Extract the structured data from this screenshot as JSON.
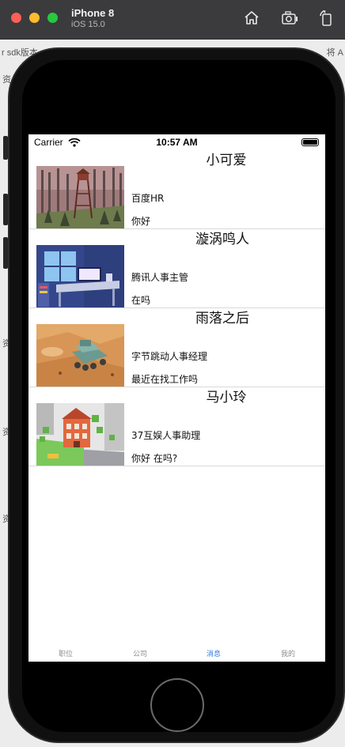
{
  "simulator": {
    "device_name": "iPhone 8",
    "os_version": "iOS 15.0",
    "toolbar_icons": [
      "home-icon",
      "screenshot-icon",
      "rotate-icon"
    ]
  },
  "background_fragments": {
    "left_top": "r sdk版本",
    "right_top": "将 A",
    "left_1": "资",
    "left_2": "资",
    "left_3": "资",
    "left_4": "资"
  },
  "status_bar": {
    "carrier": "Carrier",
    "time": "10:57 AM"
  },
  "messages": [
    {
      "name": "小可爱",
      "title": "百度HR",
      "message": "你好",
      "image": "forest-watchtower"
    },
    {
      "name": "漩涡鸣人",
      "title": "腾讯人事主管",
      "message": "在吗",
      "image": "desk-room"
    },
    {
      "name": "雨落之后",
      "title": "字节跳动人事经理",
      "message": "最近在找工作吗",
      "image": "desert-vehicle"
    },
    {
      "name": "马小玲",
      "title": "37互娱人事助理",
      "message": "你好 在吗?",
      "image": "city-building"
    }
  ],
  "tab_bar": {
    "tabs": [
      {
        "label": "职位",
        "active": false
      },
      {
        "label": "公司",
        "active": false
      },
      {
        "label": "消息",
        "active": true
      },
      {
        "label": "我的",
        "active": false
      }
    ]
  },
  "colors": {
    "active_tab": "#2f7ae5",
    "inactive_tab": "#8e8e93"
  }
}
